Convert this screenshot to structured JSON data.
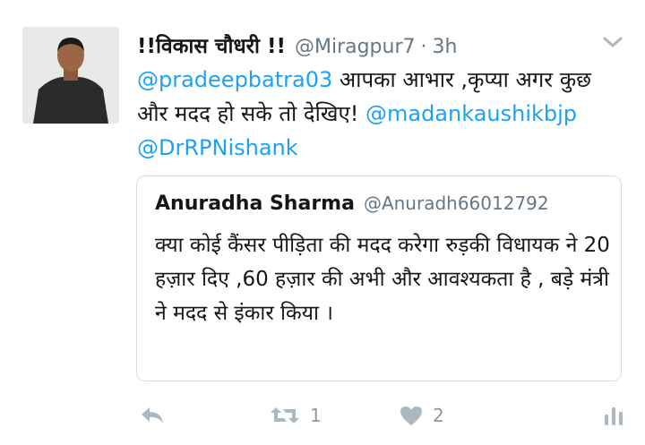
{
  "tweet": {
    "display_name": "!!विकास चौधरी !!",
    "handle": "@Miragpur7",
    "separator": "·",
    "time": "3h",
    "mention_1": "@pradeepbatra03",
    "text_1": " आपका आभार ,कृप्या अगर कुछ और मदद हो सके तो देखिए! ",
    "mention_2": "@madankaushikbjp",
    "mention_3": "@DrRPNishank"
  },
  "quoted_tweet": {
    "display_name": "Anuradha Sharma",
    "handle": "@Anuradh66012792",
    "text": "क्या कोई कैंसर पीड़िता की मदद करेगा रुड़की विधायक ने 20 हज़ार दिए ,60 हज़ार की अभी और आवश्यकता है , बड़े मंत्री ने मदद से इंकार किया ।"
  },
  "actions": {
    "reply_icon": "reply-icon",
    "retweet_icon": "retweet-icon",
    "retweet_count": "1",
    "like_icon": "heart-icon",
    "like_count": "2",
    "analytics_icon": "analytics-icon"
  },
  "colors": {
    "link": "#1da1f2",
    "secondary_text": "#657786",
    "icon_gray": "#aab8c2",
    "border": "#d6dde3"
  }
}
